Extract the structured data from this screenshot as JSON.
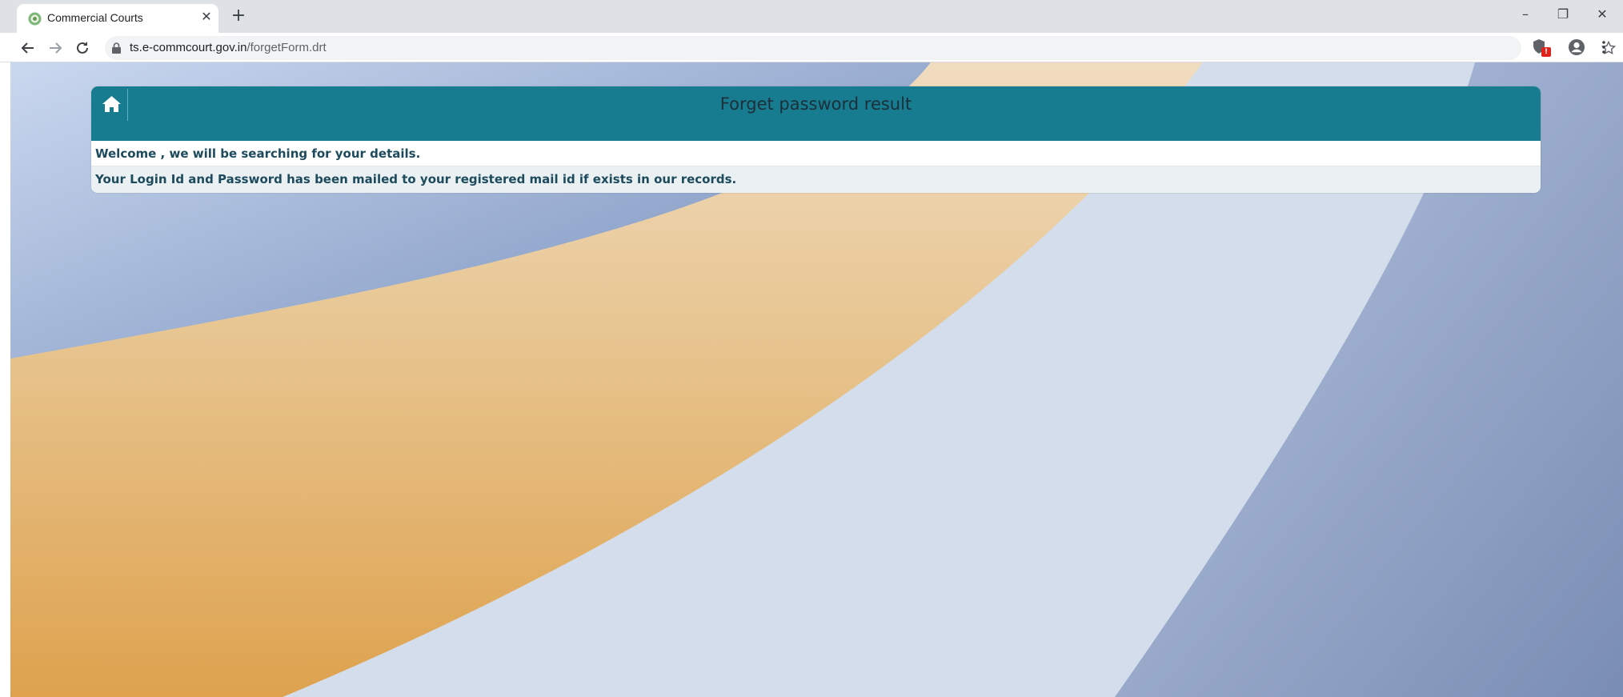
{
  "browser": {
    "tab_title": "Commercial Courts",
    "tab_close": "✕",
    "new_tab": "+",
    "window": {
      "minimize": "–",
      "restore": "❐",
      "close": "✕"
    },
    "url_host": "ts.e-commcourt.gov.in",
    "url_path": "/forgetForm.drt",
    "extension_badge": "!"
  },
  "page": {
    "title": "Forget password result",
    "rows": [
      "Welcome , we will be searching for your details.",
      "Your Login Id and Password has been mailed to your registered mail id if exists in our records."
    ]
  },
  "colors": {
    "header": "#177c8f",
    "text": "#1d4a5c",
    "background_light": "#c9d6ea",
    "background_orange": "#e1a755",
    "background_dark": "#7f93b8"
  }
}
